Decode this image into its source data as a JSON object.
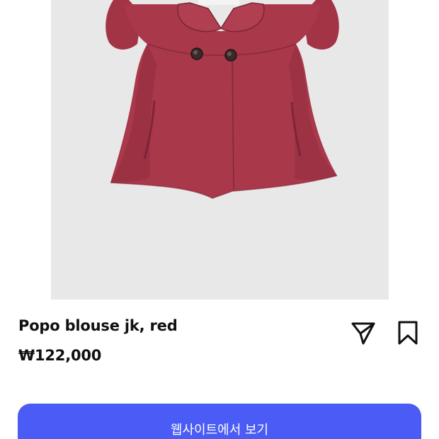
{
  "product": {
    "name": "Popo blouse jk, red",
    "price": "₩122,000",
    "image_alt": "red short-sleeve blouse jacket",
    "image_bg_color": "#e8e8e9",
    "garment_color": "#a8384a"
  },
  "actions": {
    "share_icon": "send-icon",
    "save_icon": "bookmark-icon",
    "cta_label": "웹사이트에서 보기",
    "cta_color": "#4a5cf5"
  }
}
